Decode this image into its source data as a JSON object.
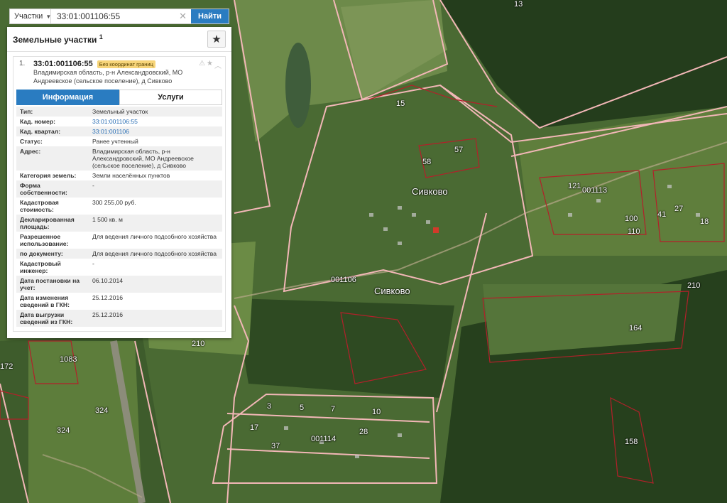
{
  "search": {
    "type_label": "Участки",
    "query": "33:01:001106:55",
    "find_label": "Найти"
  },
  "panel": {
    "title": "Земельные участки",
    "count": "1"
  },
  "result": {
    "index": "1.",
    "cad_number": "33:01:001106:55",
    "badge": "Без координат границ",
    "address_lines": [
      "Владимирская область, р-н Александровский, МО",
      "Андреевское (сельское поселение), д Сивково"
    ]
  },
  "tabs": {
    "info": "Информация",
    "services": "Услуги"
  },
  "details": [
    {
      "label": "Тип:",
      "value": "Земельный участок"
    },
    {
      "label": "Кад. номер:",
      "value": "33:01:001106:55"
    },
    {
      "label": "Кад. квартал:",
      "value": "33:01:001106"
    },
    {
      "label": "Статус:",
      "value": "Ранее учтенный"
    },
    {
      "label": "Адрес:",
      "value": "Владимирская область, р-н Александровский, МО Андреевское (сельское поселение), д Сивково"
    },
    {
      "label": "Категория земель:",
      "value": "Земли населённых пунктов"
    },
    {
      "label": "Форма собственности:",
      "value": "-"
    },
    {
      "label": "Кадастровая стоимость:",
      "value": "300 255,00 руб."
    },
    {
      "label": "Декларированная площадь:",
      "value": "1 500 кв. м"
    },
    {
      "label": "Разрешенное использование:",
      "value": "Для ведения личного подсобного хозяйства"
    },
    {
      "label": "по документу:",
      "value": "Для ведения личного подсобного хозяйства"
    },
    {
      "label": "Кадастровый инженер:",
      "value": "-"
    },
    {
      "label": "Дата постановки на учет:",
      "value": "06.10.2014"
    },
    {
      "label": "Дата изменения сведений в ГКН:",
      "value": "25.12.2016"
    },
    {
      "label": "Дата выгрузки сведений из ГКН:",
      "value": "25.12.2016"
    }
  ],
  "map_labels": {
    "village_1": "Сивково",
    "village_2": "Сивково",
    "quarter_1": "001106",
    "quarter_2": "001114",
    "quarter_3": "001113",
    "road_1": "210",
    "road_2": "210",
    "num_1083": "1083",
    "num_172": "172",
    "num_324a": "324",
    "num_324b": "324",
    "num_164": "164",
    "num_158": "158",
    "num_13": "13",
    "num_57": "57",
    "num_58": "58",
    "num_15": "15",
    "num_3": "3",
    "num_5": "5",
    "num_7": "7",
    "num_10": "10",
    "num_17": "17",
    "num_28": "28",
    "num_37": "37",
    "num_121": "121",
    "num_100": "100",
    "num_110": "110",
    "num_41": "41",
    "num_27": "27",
    "num_18": "18"
  },
  "colors": {
    "accent": "#2a7cc1",
    "badge": "#f7d57a",
    "parcel_line": "#f2b7b7",
    "parcel_outline": "#b3202a"
  }
}
